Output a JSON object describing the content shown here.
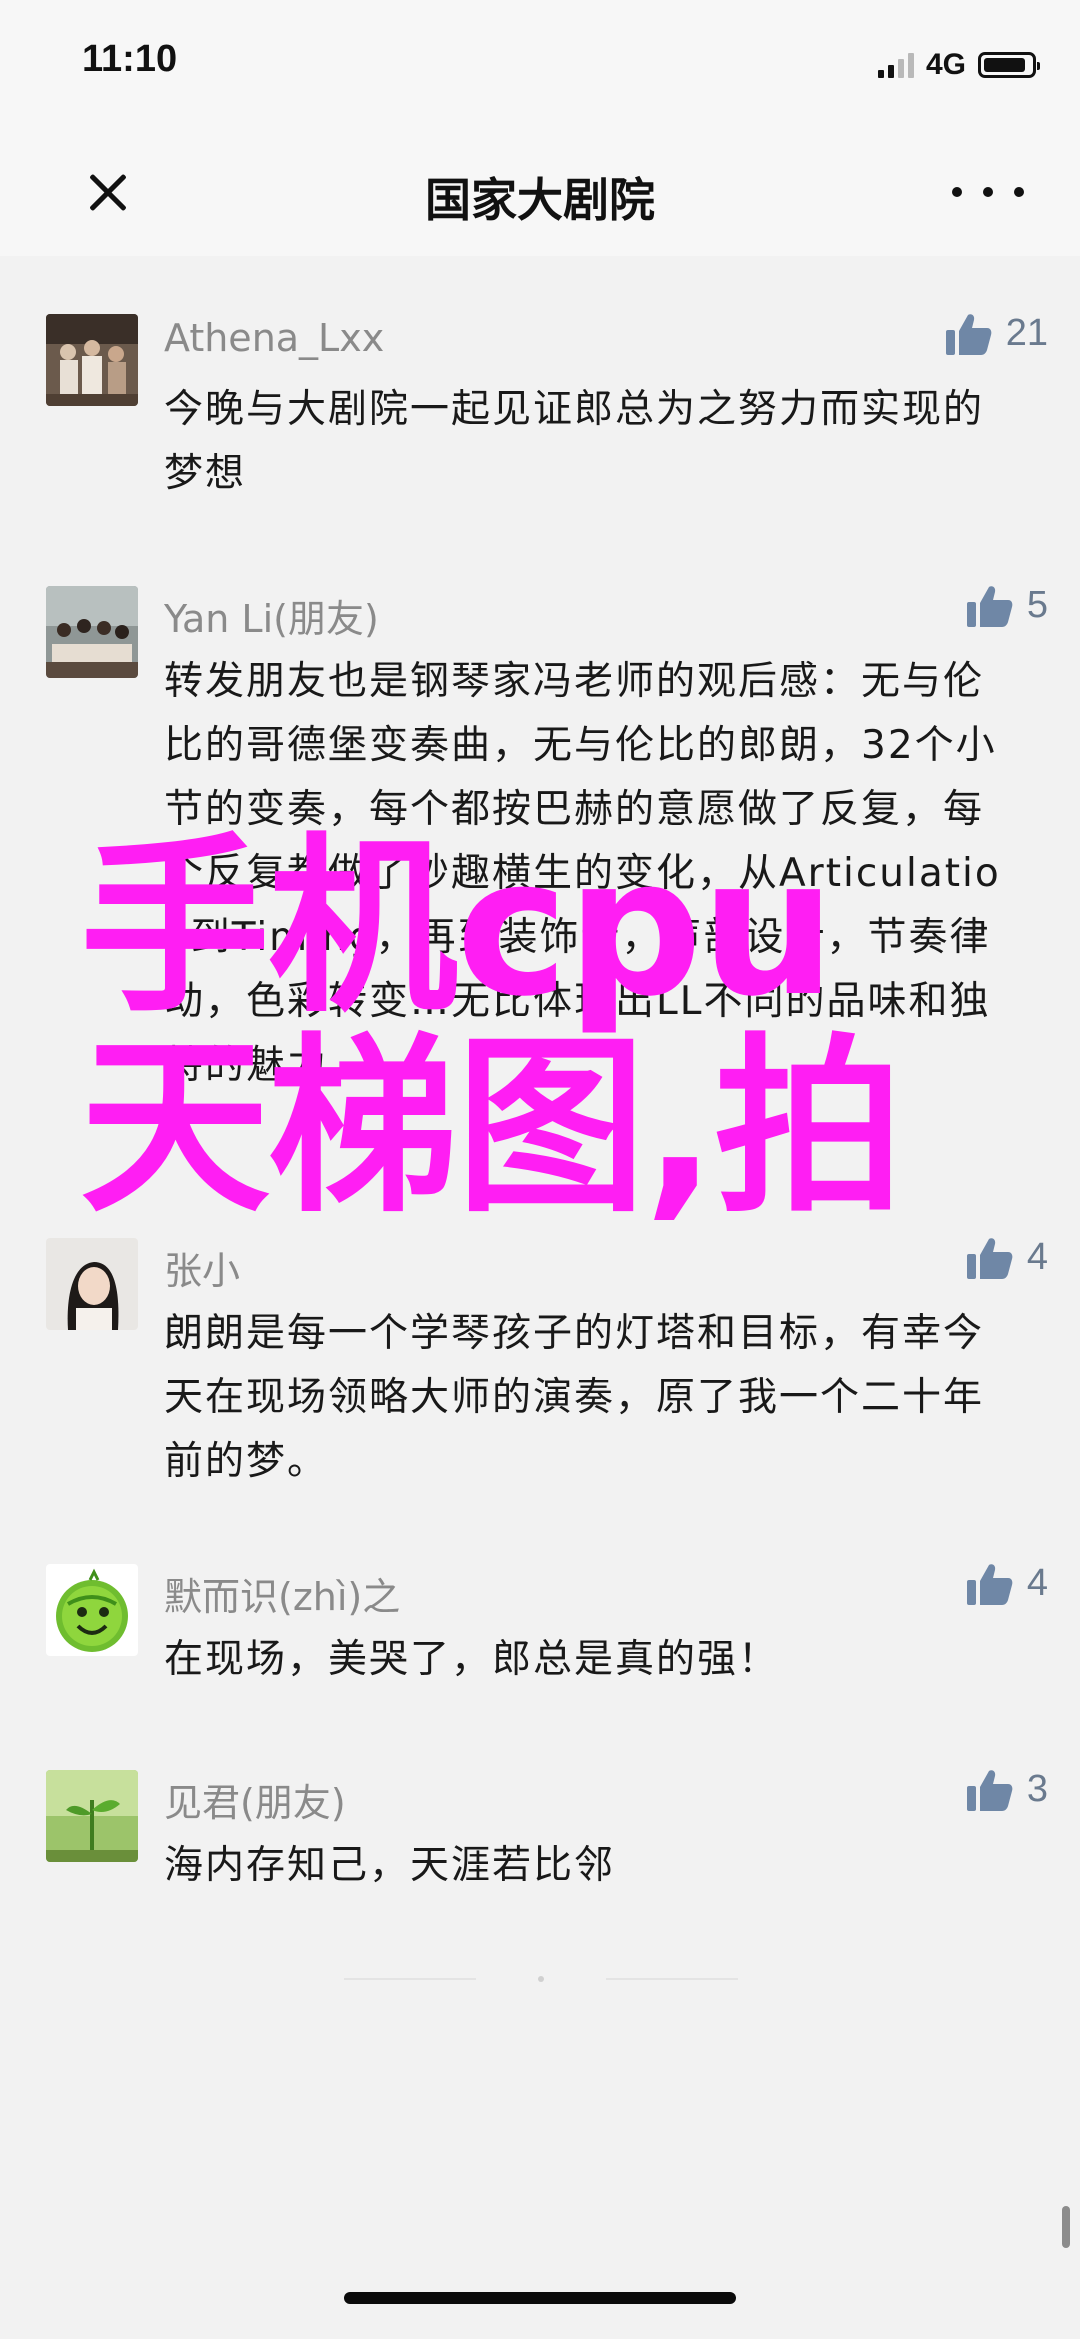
{
  "status_bar": {
    "time": "11:10",
    "network": "4G",
    "battery_level": 0.9
  },
  "nav": {
    "title": "国家大剧院",
    "close_icon": "close-icon",
    "more_icon": "more-icon"
  },
  "comments": [
    {
      "name": "Athena_Lxx",
      "likes": "21",
      "text": "今晚与大剧院一起见证郎总为之努力而实现的梦想"
    },
    {
      "name": "Yan Li(朋友)",
      "likes": "5",
      "text": "转发朋友也是钢琴家冯老师的观后感：无与伦比的哥德堡变奏曲，无与伦比的郎朗，32个小节的变奏，每个都按巴赫的意愿做了反复，每个反复都做了妙趣横生的变化，从Articulation到Timing，再到装饰音，声部设计，节奏律动，色彩转变…无比体现出LL不同的品味和独特的魅力"
    },
    {
      "name": "张小",
      "likes": "4",
      "text": "朗朗是每一个学琴孩子的灯塔和目标，有幸今天在现场领略大师的演奏，原了我一个二十年前的梦。"
    },
    {
      "name": "默而识(zhì)之",
      "likes": "4",
      "text": "在现场，美哭了，郎总是真的强！"
    },
    {
      "name": "见君(朋友)",
      "likes": "3",
      "text": "海内存知己，天涯若比邻"
    }
  ],
  "watermark": {
    "text": "手机cpu天梯图,拍",
    "color": "#ff1ef3"
  },
  "colors": {
    "background": "#f2f2f2",
    "name_gray": "#8a8a8a",
    "like_blue": "#6a7a8e"
  }
}
